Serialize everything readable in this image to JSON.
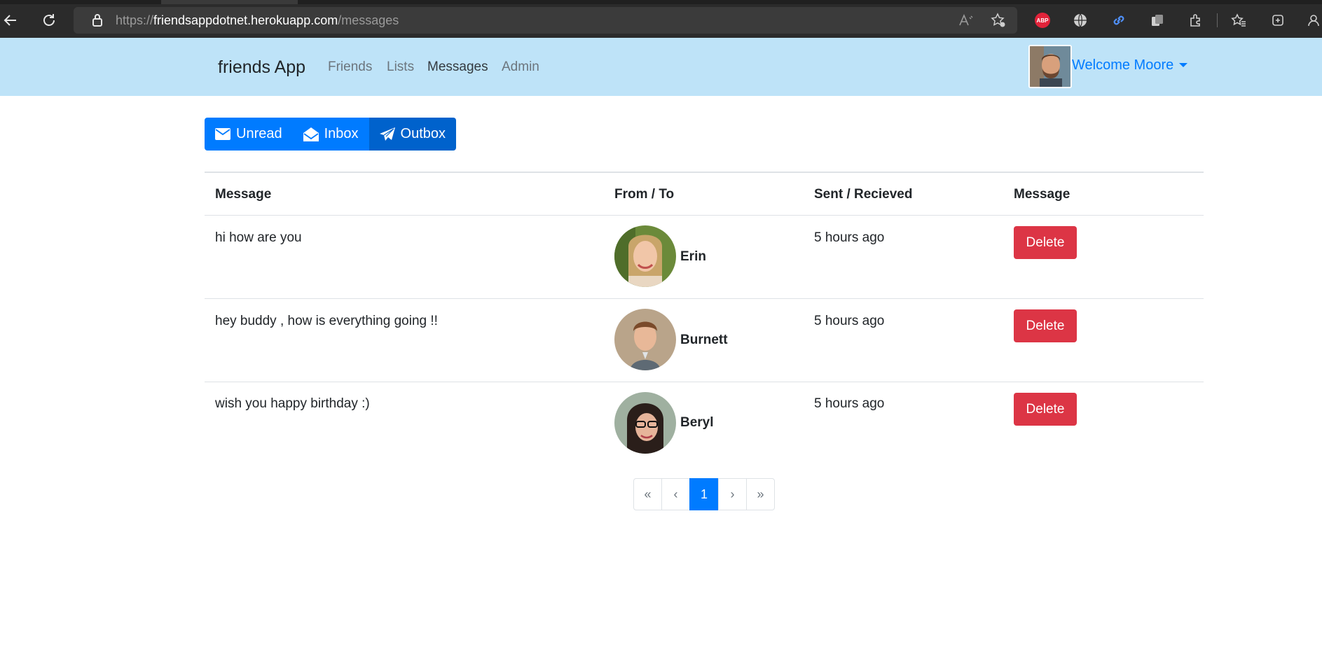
{
  "browser": {
    "url_protocol": "https://",
    "url_host": "friendsappdotnet.herokuapp.com",
    "url_path": "/messages",
    "extension_abp_label": "ABP"
  },
  "navbar": {
    "brand": "friends App",
    "links": [
      "Friends",
      "Lists",
      "Messages",
      "Admin"
    ],
    "active_link": "Messages",
    "welcome": "Welcome Moore"
  },
  "message_tabs": [
    {
      "label": "Unread",
      "icon": "envelope-icon"
    },
    {
      "label": "Inbox",
      "icon": "envelope-open-icon"
    },
    {
      "label": "Outbox",
      "icon": "paper-plane-icon",
      "active": true
    }
  ],
  "table": {
    "headers": [
      "Message",
      "From / To",
      "Sent / Recieved",
      "Message"
    ],
    "rows": [
      {
        "message": "hi how are you",
        "name": "Erin",
        "time": "5 hours ago",
        "action": "Delete"
      },
      {
        "message": "hey buddy , how is everything going !!",
        "name": "Burnett",
        "time": "5 hours ago",
        "action": "Delete"
      },
      {
        "message": "wish you happy birthday :)",
        "name": "Beryl",
        "time": "5 hours ago",
        "action": "Delete"
      }
    ]
  },
  "pagination": {
    "first": "«",
    "prev": "‹",
    "current": "1",
    "next": "›",
    "last": "»"
  },
  "colors": {
    "navbar_bg": "#bee3f8",
    "primary": "#007bff",
    "primary_active": "#0062cc",
    "danger": "#dc3545"
  }
}
